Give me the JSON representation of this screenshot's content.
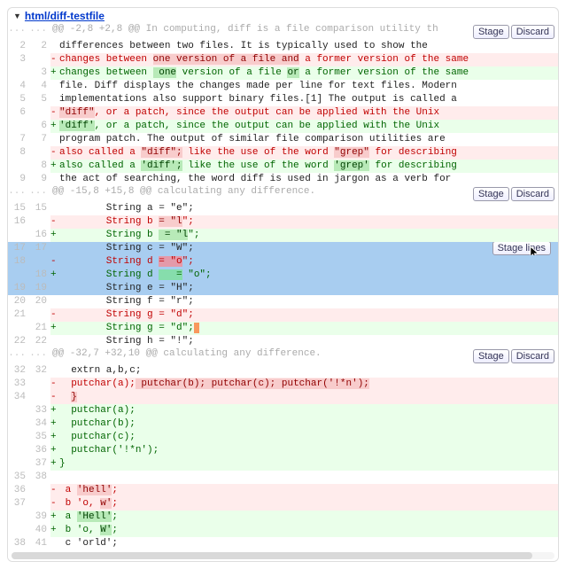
{
  "file": {
    "path": "html/diff-testfile"
  },
  "buttons": {
    "stage": "Stage",
    "discard": "Discard",
    "stage_lines": "Stage lines"
  },
  "hunks": [
    {
      "header": "@@ -2,8 +2,8 @@ In computing, diff is a file comparison utility th"
    },
    {
      "header": "@@ -15,8 +15,8 @@ calculating any difference."
    },
    {
      "header": "@@ -32,7 +32,10 @@ calculating any difference."
    }
  ],
  "h1_lines": {
    "l1_old": "2",
    "l1_new": "2",
    "l1_txt": "differences between two files. It is typically used to show the",
    "l2_old": "3",
    "l2_prefix": "changes between ",
    "l2_mark": "one version of a file and",
    "l2_suffix": " a former version of the same",
    "l3_new": "3",
    "l3_prefix": "changes between ",
    "l3_mark1": " one",
    "l3_mid": " version of a file ",
    "l3_mark2": "or",
    "l3_suffix": " a former version of the same",
    "l4_old": "4",
    "l4_new": "4",
    "l4_txt": "file. Diff displays the changes made per line for text files. Modern",
    "l5_old": "5",
    "l5_new": "5",
    "l5_txt": "implementations also support binary files.[1] The output is called a",
    "l6_old": "6",
    "l6_mark": "\"diff\"",
    "l6_suffix": ", or a patch, since the output can be applied with the Unix",
    "l7_new": "6",
    "l7_mark": "'diff'",
    "l7_suffix": ", or a patch, since the output can be applied with the Unix",
    "l8_old": "7",
    "l8_new": "7",
    "l8_txt": "program patch. The output of similar file comparison utilities are",
    "l9_old": "8",
    "l9_prefix": "also called a ",
    "l9_mark1": "\"diff\";",
    "l9_mid": " like the use of the word ",
    "l9_mark2": "\"grep\"",
    "l9_suffix": " for describing",
    "l10_new": "8",
    "l10_prefix": "also called a ",
    "l10_mark1": "'diff';",
    "l10_mid": " like the use of the word ",
    "l10_mark2": "'grep'",
    "l10_suffix": " for describing",
    "l11_old": "9",
    "l11_new": "9",
    "l11_txt": "the act of searching, the word diff is used in jargon as a verb for"
  },
  "h2_lines": {
    "l1_old": "15",
    "l1_new": "15",
    "l1_txt": "        String a = \"e\";",
    "l2_old": "16",
    "l2_prefix": "        String b ",
    "l2_mark": "= \"l",
    "l2_suffix": "\";",
    "l3_new": "16",
    "l3_prefix": "        String b ",
    "l3_mark": " = \"l",
    "l3_suffix": "\";",
    "l4_old": "17",
    "l4_new": "17",
    "l4_txt": "        String c = \"W\";",
    "l5_old": "18",
    "l5_prefix": "        String d ",
    "l5_mark": "= \"o",
    "l5_suffix": "\";",
    "l6_new": "18",
    "l6_prefix": "        String d ",
    "l6_mark": "   =",
    "l6_mid": " \"o\";",
    "l7_old": "19",
    "l7_new": "19",
    "l7_txt": "        String e = \"H\";",
    "l8_old": "20",
    "l8_new": "20",
    "l8_txt": "        String f = \"r\";",
    "l9_old": "21",
    "l9_prefix": "        String g = \"d\";",
    "l10_new": "21",
    "l10_prefix": "        String g = \"d\";",
    "l10_mark": " ",
    "l11_old": "22",
    "l11_new": "22",
    "l11_txt": "        String h = \"!\";"
  },
  "h3_lines": {
    "l1_old": "32",
    "l1_new": "32",
    "l1_txt": "  extrn a,b,c;",
    "l2_old": "33",
    "l2_prefix": "  putchar(a);",
    "l2_mark1": " putchar(b); ",
    "l2_mark2": "putchar(c); ",
    "l2_mark3": "putchar('!*n');",
    "l3_old": "34",
    "l3_mark": "}",
    "l4_new": "33",
    "l4_txt": "  putchar(a);",
    "l5_new": "34",
    "l5_txt": "  putchar(b);",
    "l6_new": "35",
    "l6_txt": "  putchar(c);",
    "l7_new": "36",
    "l7_txt": "  putchar('!*n');",
    "l8_new": "37",
    "l8_txt": "}",
    "l9_old": "35",
    "l9_new": "38",
    "l9_txt": "",
    "l10_old": "36",
    "l10_prefix": " a ",
    "l10_mark": "'hell'",
    "l10_suffix": ";",
    "l11_old": "37",
    "l11_prefix": " b 'o, ",
    "l11_mark": "w'",
    "l11_suffix": ";",
    "l12_new": "39",
    "l12_prefix": " a ",
    "l12_mark": "'Hell'",
    "l12_suffix": ";",
    "l13_new": "40",
    "l13_prefix": " b 'o, ",
    "l13_mark": "W'",
    "l13_suffix": ";",
    "l14_old": "38",
    "l14_new": "41",
    "l14_txt": " c 'orld';"
  }
}
